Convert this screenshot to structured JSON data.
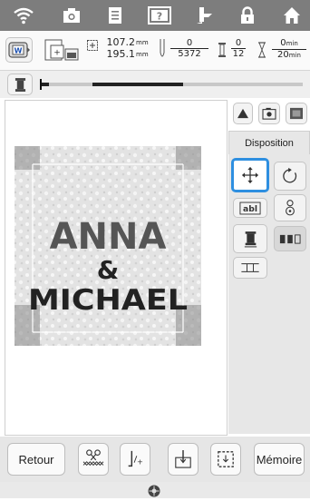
{
  "status_bar": {
    "icons": [
      "wifi-icon",
      "camera-icon",
      "document-icon",
      "help-icon",
      "thread-icon",
      "lock-icon",
      "home-icon"
    ]
  },
  "info": {
    "width": "107.2",
    "height": "195.1",
    "size_unit": "mm",
    "stitch_current": "0",
    "stitch_total": "5372",
    "color_current": "0",
    "color_total": "12",
    "time_current": "0",
    "time_total": "20",
    "time_unit": "min"
  },
  "design": {
    "line1": "ANNA",
    "line2": "&",
    "line3": "MICHAEL"
  },
  "right_panel": {
    "tab_label": "Disposition"
  },
  "bottom": {
    "back_label": "Retour",
    "memory_label": "Mémoire"
  },
  "colors": {
    "accent": "#2e8fe0",
    "topbar": "#7d7d7d"
  }
}
